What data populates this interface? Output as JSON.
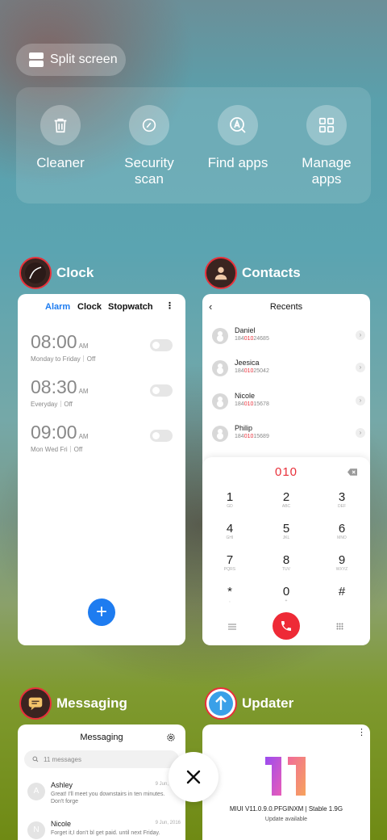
{
  "split_screen": {
    "label": "Split screen"
  },
  "tools": [
    {
      "label": "Cleaner",
      "icon": "trash-icon"
    },
    {
      "label": "Security\nscan",
      "icon": "shield-scan-icon"
    },
    {
      "label": "Find apps",
      "icon": "find-apps-icon"
    },
    {
      "label": "Manage\napps",
      "icon": "grid-icon"
    }
  ],
  "apps": {
    "clock": {
      "title": "Clock",
      "tabs": [
        "Alarm",
        "Clock",
        "Stopwatch"
      ],
      "alarms": [
        {
          "time": "08:00",
          "ampm": "AM",
          "repeat": "Monday to Friday｜Off"
        },
        {
          "time": "08:30",
          "ampm": "AM",
          "repeat": "Everyday｜Off"
        },
        {
          "time": "09:00",
          "ampm": "AM",
          "repeat": "Mon Wed Fri｜Off"
        }
      ],
      "fab_label": "+"
    },
    "contacts": {
      "title": "Contacts",
      "header": "Recents",
      "recents": [
        {
          "name": "Daniel",
          "num_pre": "184",
          "num_hl": "010",
          "num_post": "24685"
        },
        {
          "name": "Jeesica",
          "num_pre": "184",
          "num_hl": "010",
          "num_post": "25042"
        },
        {
          "name": "Nicole",
          "num_pre": "184",
          "num_hl": "010",
          "num_post": "15678"
        },
        {
          "name": "Philip",
          "num_pre": "184",
          "num_hl": "010",
          "num_post": "15689"
        }
      ],
      "dial_entry": "010",
      "keys": [
        {
          "d": "1",
          "l": "GD"
        },
        {
          "d": "2",
          "l": "ABC"
        },
        {
          "d": "3",
          "l": "DEF"
        },
        {
          "d": "4",
          "l": "GHI"
        },
        {
          "d": "5",
          "l": "JKL"
        },
        {
          "d": "6",
          "l": "MNO"
        },
        {
          "d": "7",
          "l": "PQRS"
        },
        {
          "d": "8",
          "l": "TUV"
        },
        {
          "d": "9",
          "l": "WXYZ"
        },
        {
          "d": "*",
          "l": ","
        },
        {
          "d": "0",
          "l": "+"
        },
        {
          "d": "#",
          "l": ""
        }
      ]
    },
    "messaging": {
      "title": "Messaging",
      "header": "Messaging",
      "search_placeholder": "11 messages",
      "messages": [
        {
          "initial": "A",
          "name": "Ashley",
          "date": "9 Jun, 2016",
          "text": "Great! I'll meet you downstairs in ten minutes. Don't forge"
        },
        {
          "initial": "N",
          "name": "Nicole",
          "date": "9 Jun, 2016",
          "text": "Forget it,I don't bl get paid. until next Friday."
        }
      ]
    },
    "updater": {
      "title": "Updater",
      "version": "MIUI V11.0.9.0.PFGINXM | Stable 1.9G",
      "status": "Update available"
    }
  },
  "colors": {
    "accent_blue": "#1e7cf0",
    "accent_red": "#e8303a",
    "call_red": "#ee2a36"
  }
}
